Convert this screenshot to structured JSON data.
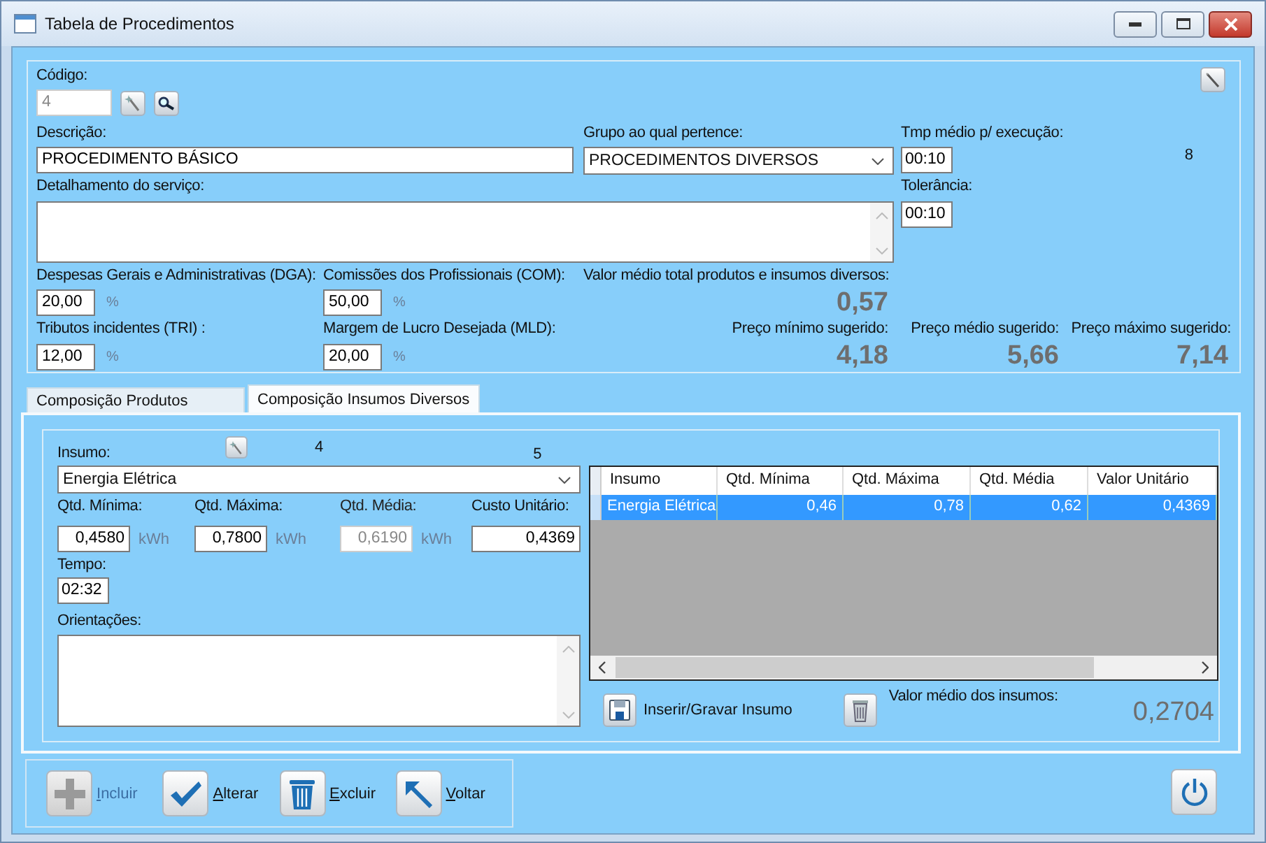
{
  "window": {
    "title": "Tabela de Procedimentos"
  },
  "header": {
    "codigo": {
      "label": "Código:",
      "value": "4",
      "disabled": true
    },
    "descricao": {
      "label": "Descrição:",
      "value": "PROCEDIMENTO BÁSICO"
    },
    "grupo": {
      "label": "Grupo ao qual pertence:",
      "value": "PROCEDIMENTOS DIVERSOS"
    },
    "tempo_medio": {
      "label": "Tmp médio p/ execução:",
      "value": "00:10"
    },
    "counter": "8",
    "detalhamento": {
      "label": "Detalhamento do serviço:"
    },
    "tolerancia": {
      "label": "Tolerância:",
      "value": "00:10"
    },
    "percent_fields": [
      {
        "label": "Despesas Gerais e Administrativas (DGA):",
        "value": "20,00",
        "unit": "%"
      },
      {
        "label": "Comissões dos Profissionais (COM):",
        "value": "50,00",
        "unit": "%"
      },
      {
        "label": "Tributos incidentes (TRI) :",
        "value": "12,00",
        "unit": "%"
      },
      {
        "label": "Margem de Lucro Desejada (MLD):",
        "value": "20,00",
        "unit": "%"
      }
    ],
    "valor_medio": {
      "label": "Valor médio total produtos e insumos diversos:",
      "value": "0,57"
    },
    "precos": [
      {
        "label": "Preço mínimo sugerido:",
        "value": "4,18"
      },
      {
        "label": "Preço médio sugerido:",
        "value": "5,66"
      },
      {
        "label": "Preço máximo sugerido:",
        "value": "7,14"
      }
    ]
  },
  "tabs": [
    {
      "label": "Composição Produtos",
      "selected": false
    },
    {
      "label": "Composição Insumos Diversos",
      "selected": true
    }
  ],
  "insumo_form": {
    "insumo": {
      "label": "Insumo:",
      "value": "Energia Elétrica"
    },
    "markers": [
      "4",
      "5"
    ],
    "quantities": [
      {
        "label": "Qtd. Mínima:",
        "value": "0,4580",
        "unit": "kWh",
        "disabled": false
      },
      {
        "label": "Qtd. Máxima:",
        "value": "0,7800",
        "unit": "kWh",
        "disabled": false
      },
      {
        "label": "Qtd. Média:",
        "value": "0,6190",
        "unit": "kWh",
        "disabled": true
      },
      {
        "label": "Custo Unitário:",
        "value": "0,4369",
        "disabled": false
      }
    ],
    "tempo": {
      "label": "Tempo:",
      "value": "02:32"
    },
    "orientacoes": {
      "label": "Orientações:"
    }
  },
  "table": {
    "columns": [
      "Insumo",
      "Qtd. Mínima",
      "Qtd. Máxima",
      "Qtd. Média",
      "Valor Unitário"
    ],
    "rows": [
      {
        "cells": [
          "Energia Elétrica",
          "0,46",
          "0,78",
          "0,62",
          "0,4369"
        ],
        "selected": true
      }
    ]
  },
  "save_button": {
    "label": "Inserir/Gravar Insumo"
  },
  "valor_medio_insumos": {
    "label": "Valor médio dos insumos:",
    "value": "0,2704"
  },
  "toolbar": [
    {
      "label": "Incluir",
      "kind": "add",
      "disabled": true
    },
    {
      "label": "Alterar",
      "kind": "edit",
      "disabled": false
    },
    {
      "label": "Excluir",
      "kind": "delete",
      "disabled": false
    },
    {
      "label": "Voltar",
      "kind": "back",
      "disabled": false
    }
  ]
}
